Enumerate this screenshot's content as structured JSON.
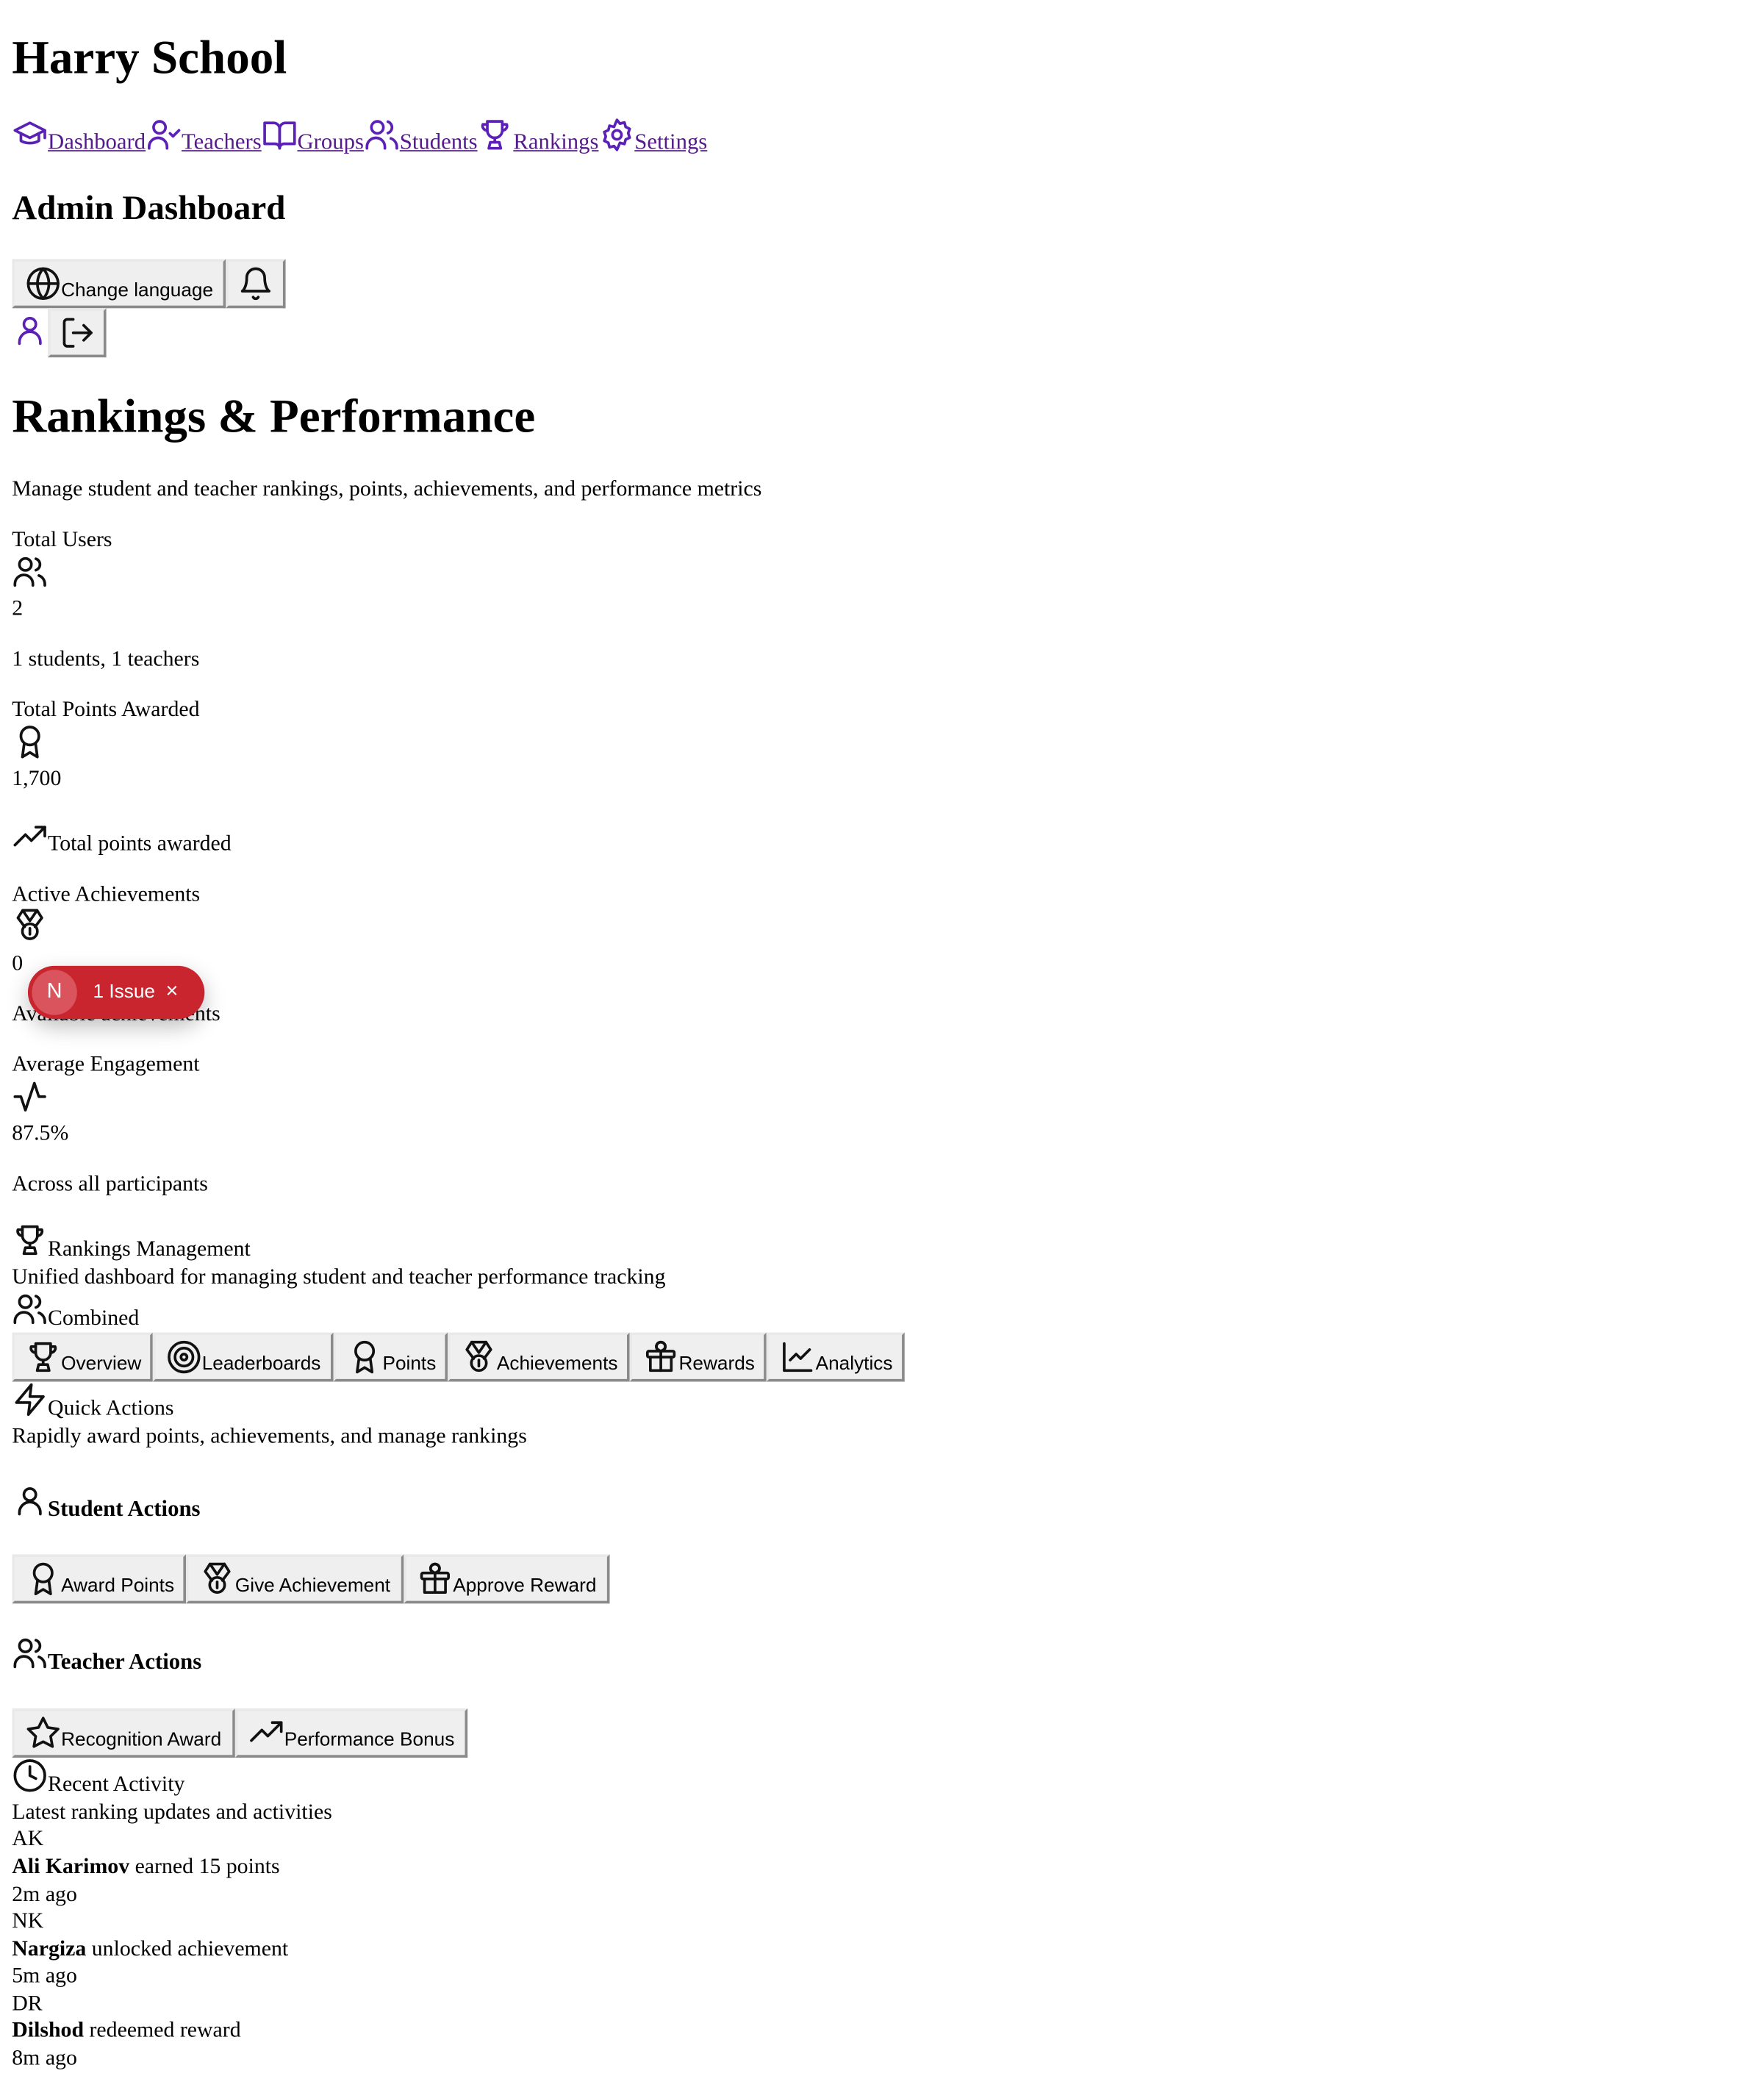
{
  "brand": "Harry School",
  "nav": [
    {
      "label": "Dashboard",
      "icon": "graduation-cap-icon"
    },
    {
      "label": "Teachers",
      "icon": "user-check-icon"
    },
    {
      "label": "Groups",
      "icon": "book-open-icon"
    },
    {
      "label": "Students",
      "icon": "users-icon"
    },
    {
      "label": "Rankings",
      "icon": "trophy-icon"
    },
    {
      "label": "Settings",
      "icon": "gear-icon"
    }
  ],
  "header": {
    "title": "Admin Dashboard",
    "change_language": "Change language"
  },
  "page": {
    "title": "Rankings & Performance",
    "subtitle": "Manage student and teacher rankings, points, achievements, and performance metrics"
  },
  "stats": {
    "total_users": {
      "label": "Total Users",
      "value": "2",
      "note": "1 students, 1 teachers"
    },
    "total_points": {
      "label": "Total Points Awarded",
      "value": "1,700",
      "note": "Total points awarded"
    },
    "active_achievements": {
      "label": "Active Achievements",
      "value": "0",
      "note": "Available achievements"
    },
    "avg_engagement": {
      "label": "Average Engagement",
      "value": "87.5%",
      "note": "Across all participants"
    }
  },
  "rankings": {
    "title": "Rankings Management",
    "description": "Unified dashboard for managing student and teacher performance tracking",
    "view_mode": "Combined",
    "tabs": [
      "Overview",
      "Leaderboards",
      "Points",
      "Achievements",
      "Rewards",
      "Analytics"
    ]
  },
  "quick_actions": {
    "title": "Quick Actions",
    "description": "Rapidly award points, achievements, and manage rankings",
    "student_heading": "Student Actions",
    "student_buttons": [
      "Award Points",
      "Give Achievement",
      "Approve Reward"
    ],
    "teacher_heading": "Teacher Actions",
    "teacher_buttons": [
      "Recognition Award",
      "Performance Bonus"
    ]
  },
  "recent_activity": {
    "title": "Recent Activity",
    "description": "Latest ranking updates and activities",
    "items": [
      {
        "initials": "AK",
        "name": "Ali Karimov",
        "action": " earned 15 points",
        "time": "2m ago"
      },
      {
        "initials": "NK",
        "name": "Nargiza",
        "action": " unlocked achievement",
        "time": "5m ago"
      },
      {
        "initials": "DR",
        "name": "Dilshod",
        "action": " redeemed reward",
        "time": "8m ago"
      }
    ]
  },
  "issue_badge": {
    "letter": "N",
    "label": "1 Issue",
    "close": "×"
  },
  "colors": {
    "link": "#551a8b",
    "icon_accent": "#5b21b6",
    "issue_badge": "#c9252f"
  }
}
